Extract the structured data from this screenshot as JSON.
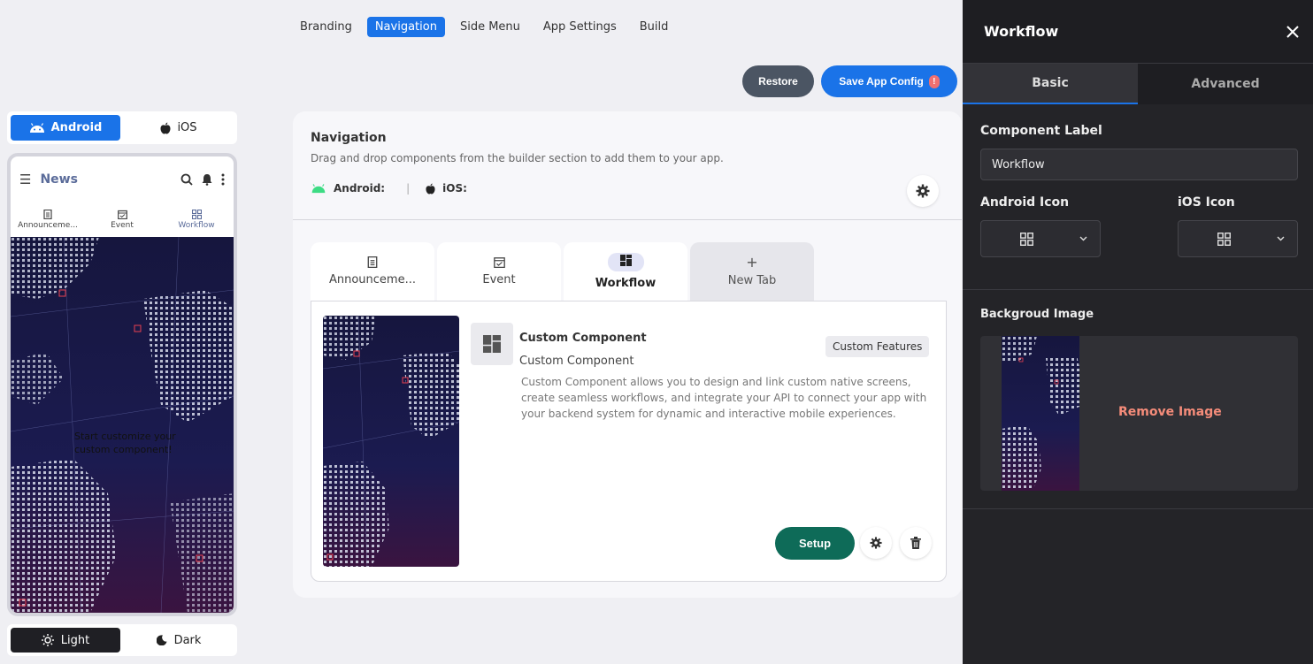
{
  "top_nav": {
    "tabs": [
      "Branding",
      "Navigation",
      "Side Menu",
      "App Settings",
      "Build"
    ],
    "active": "Navigation"
  },
  "actions": {
    "restore_label": "Restore",
    "save_label": "Save App Config",
    "save_warning": "!"
  },
  "platform_toggle": {
    "android_label": "Android",
    "ios_label": "iOS",
    "active": "Android"
  },
  "phone_preview": {
    "app_title": "News",
    "tabs": [
      {
        "label": "Announceme...",
        "icon": "document-icon"
      },
      {
        "label": "Event",
        "icon": "calendar-icon"
      },
      {
        "label": "Workflow",
        "icon": "grid-icon"
      }
    ],
    "active_tab": "Workflow",
    "overlay_text_line1": "Start customize your",
    "overlay_text_line2": "custom component!"
  },
  "theme_toggle": {
    "light_label": "Light",
    "dark_label": "Dark",
    "active": "Light"
  },
  "navigation_card": {
    "heading": "Navigation",
    "description": "Drag and drop components from the builder section to add them to your app.",
    "android_label": "Android:",
    "ios_label": "iOS:",
    "tabs": [
      {
        "label": "Announceme...",
        "icon": "document-icon"
      },
      {
        "label": "Event",
        "icon": "calendar-icon"
      },
      {
        "label": "Workflow",
        "icon": "dashboard-icon"
      },
      {
        "label": "New Tab",
        "icon": "plus-icon"
      }
    ],
    "active_tab": "Workflow",
    "component": {
      "title": "Custom Component",
      "subtitle": "Custom Component",
      "badge": "Custom Features",
      "description": "Custom Component allows you to design and link custom native screens, create seamless workflows, and integrate your API to connect your app with your backend system for dynamic and interactive mobile experiences.",
      "setup_label": "Setup"
    }
  },
  "right_panel": {
    "title": "Workflow",
    "tabs": [
      "Basic",
      "Advanced"
    ],
    "active_tab": "Basic",
    "component_label_title": "Component Label",
    "component_label_value": "Workflow",
    "android_icon_title": "Android Icon",
    "ios_icon_title": "iOS Icon",
    "background_title": "Backgroud Image",
    "remove_image_label": "Remove Image"
  },
  "colors": {
    "accent": "#1a73e8",
    "setup_green": "#0e6b58",
    "panel_dark": "#242428",
    "remove_text": "#f58c7a",
    "android_green": "#3ddc84"
  }
}
